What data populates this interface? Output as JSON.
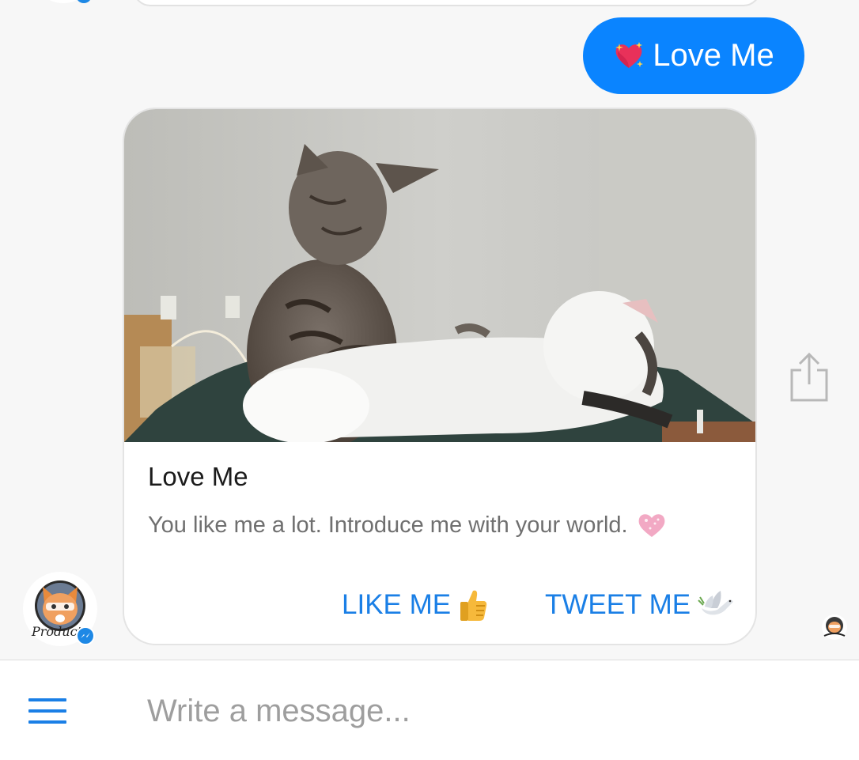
{
  "conversation": {
    "user_message": {
      "icon": "sparkling-heart-icon",
      "text": "Love Me",
      "bubble_color": "#0a84ff"
    },
    "card": {
      "image": "two-kittens-gif",
      "title": "Love Me",
      "subtitle": "You like me a lot. Introduce me with your world.",
      "subtitle_icon": "pink-heart-icon",
      "buttons": [
        {
          "label": "LIKE ME",
          "icon": "thumbs-up-icon"
        },
        {
          "label": "TWEET ME",
          "icon": "dove-icon"
        }
      ],
      "button_color": "#1a7fe6",
      "share_icon": "share-icon"
    },
    "bot_avatar": {
      "name": "bot-avatar",
      "badge": "messenger-badge-icon",
      "logo_text": "Product"
    }
  },
  "composer": {
    "placeholder": "Write a message...",
    "menu_icon": "hamburger-menu-icon"
  }
}
